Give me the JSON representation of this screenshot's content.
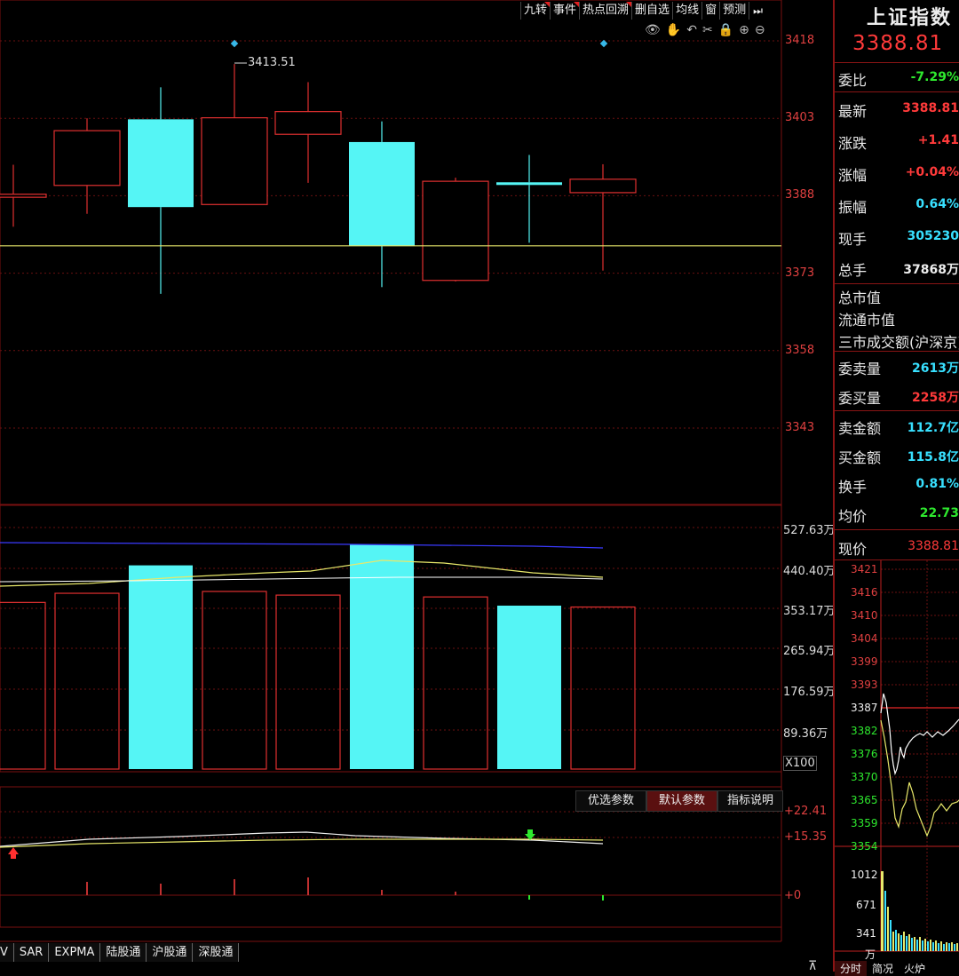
{
  "toolbar": {
    "buttons": [
      "九转",
      "事件",
      "热点回溯",
      "删自选",
      "均线",
      "窗",
      "预测"
    ],
    "arrow": "⏭"
  },
  "tools": [
    "👁",
    "✋",
    "↶",
    "✂",
    "🔒",
    "⊕",
    "⊖"
  ],
  "price_axis": {
    "labels": [
      "3418",
      "3403",
      "3388",
      "3373",
      "3358",
      "3343"
    ]
  },
  "annotation": {
    "high": "3413.51"
  },
  "volume_axis": {
    "labels": [
      "527.63万",
      "440.40万",
      "353.17万",
      "265.94万",
      "176.59万",
      "89.36万"
    ],
    "unit": "X100"
  },
  "indicator": {
    "buttons": [
      "优选参数",
      "默认参数",
      "指标说明"
    ],
    "labels": [
      "+22.41",
      "+15.35",
      "+0"
    ]
  },
  "bottom_tabs": [
    "V",
    "SAR",
    "EXPMA",
    "陆股通",
    "沪股通",
    "深股通"
  ],
  "right_panel": {
    "title": "上证指数",
    "price": "3388.81",
    "rows": [
      {
        "label": "委比",
        "value": "-7.29%",
        "color": "#2ee82e"
      },
      {
        "label": "最新",
        "value": "3388.81",
        "color": "#ff3a3a"
      },
      {
        "label": "涨跌",
        "value": "+1.41",
        "color": "#ff3a3a"
      },
      {
        "label": "涨幅",
        "value": "+0.04%",
        "color": "#ff3a3a"
      },
      {
        "label": "振幅",
        "value": "0.64%",
        "color": "#38e0ff"
      },
      {
        "label": "现手",
        "value": "305230",
        "color": "#38e0ff"
      },
      {
        "label": "总手",
        "value": "37868万",
        "color": "#eeeeee"
      }
    ],
    "mkt_rows": [
      "总市值",
      "流通市值",
      "三市成交额(沪深京)"
    ],
    "rows2": [
      {
        "label": "委卖量",
        "value": "2613万",
        "color": "#38e0ff"
      },
      {
        "label": "委买量",
        "value": "2258万",
        "color": "#ff3a3a"
      },
      {
        "label": "卖金额",
        "value": "112.7亿",
        "color": "#38e0ff"
      },
      {
        "label": "买金额",
        "value": "115.8亿",
        "color": "#38e0ff"
      },
      {
        "label": "换手",
        "value": "0.81%",
        "color": "#38e0ff"
      },
      {
        "label": "均价",
        "value": "22.73",
        "color": "#2ee82e"
      }
    ],
    "current_label": "现价",
    "current_value": "3388.81",
    "mini_price_labels": [
      "3421",
      "3416",
      "3410",
      "3404",
      "3399",
      "3393",
      "3387",
      "3382",
      "3376",
      "3370",
      "3365",
      "3359",
      "3354"
    ],
    "mini_vol_labels": [
      "1012",
      "671",
      "341",
      "万"
    ],
    "bottom_tabs": [
      "分时",
      "简况",
      "火炉"
    ]
  },
  "chart_data": {
    "type": "candlestick",
    "price_range": [
      3335,
      3418
    ],
    "candles": [
      {
        "open": 3387.7,
        "close": 3388.3,
        "high": 3394,
        "low": 3382,
        "color": "red"
      },
      {
        "open": 3390,
        "close": 3400.6,
        "high": 3403,
        "low": 3384.5,
        "color": "red"
      },
      {
        "open": 3402.8,
        "close": 3385.8,
        "high": 3409,
        "low": 3369,
        "color": "cyan"
      },
      {
        "open": 3386.3,
        "close": 3403.1,
        "high": 3413.51,
        "low": 3386.3,
        "color": "red"
      },
      {
        "open": 3399.9,
        "close": 3404.3,
        "high": 3410,
        "low": 3390.5,
        "color": "red"
      },
      {
        "open": 3398.4,
        "close": 3378.3,
        "high": 3402.4,
        "low": 3370.3,
        "color": "cyan"
      },
      {
        "open": 3371.6,
        "close": 3390.8,
        "high": 3391.5,
        "low": 3371.4,
        "color": "red"
      },
      {
        "open": 3390.6,
        "close": 3390.3,
        "high": 3395.9,
        "low": 3378.9,
        "color": "cyan"
      },
      {
        "open": 3388.6,
        "close": 3391.2,
        "high": 3394.1,
        "low": 3373.5,
        "color": "red"
      }
    ],
    "reference_line": 3378.3,
    "volumes_wan": [
      364,
      384,
      445,
      388,
      380,
      491,
      376,
      357,
      354
    ],
    "volume_range": [
      0,
      527.63
    ]
  }
}
